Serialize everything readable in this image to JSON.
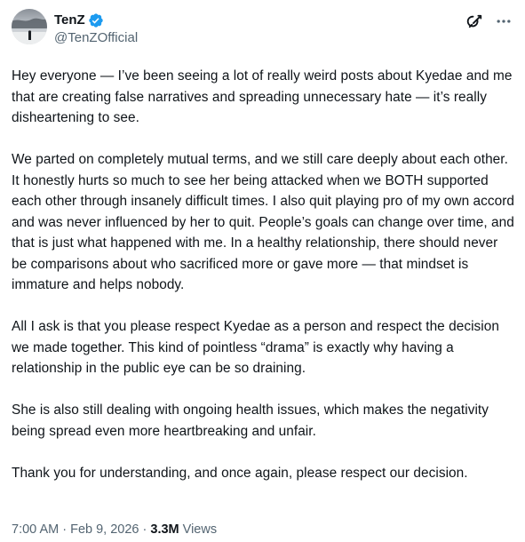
{
  "author": {
    "display_name": "TenZ",
    "handle": "@TenZOfficial",
    "verified": true,
    "verified_color": "#1d9bf0"
  },
  "header_actions": {
    "grok_icon": "grok-icon",
    "more_icon": "more-icon"
  },
  "post": {
    "paragraphs": [
      "Hey everyone — I’ve been seeing a lot of really weird posts about Kyedae and me that are creating false narratives and spreading unnecessary hate — it’s really disheartening to see.",
      "We parted on completely mutual terms, and we still care deeply about each other. It honestly hurts so much to see her being attacked when we BOTH supported each other through insanely difficult times. I also quit playing pro of my own accord and was never influenced by her to quit. People’s goals can change over time, and that is just what happened with me. In a healthy relationship, there should never be comparisons about who sacrificed more or gave more — that mindset is immature and helps nobody.",
      "All I ask is that you please respect Kyedae as a person and respect the decision we made together. This kind of pointless “drama” is exactly why having a relationship in the public eye can be so draining.",
      "She is also still dealing with ongoing health issues, which makes the negativity being spread even more heartbreaking and unfair.",
      "Thank you for understanding, and once again, please respect our decision."
    ]
  },
  "meta": {
    "time": "7:00 AM",
    "separator": " · ",
    "date": "Feb 9, 2026",
    "views_count": "3.3M",
    "views_label": "Views"
  },
  "colors": {
    "text_primary": "#0f1419",
    "text_secondary": "#536471",
    "background": "#ffffff"
  }
}
